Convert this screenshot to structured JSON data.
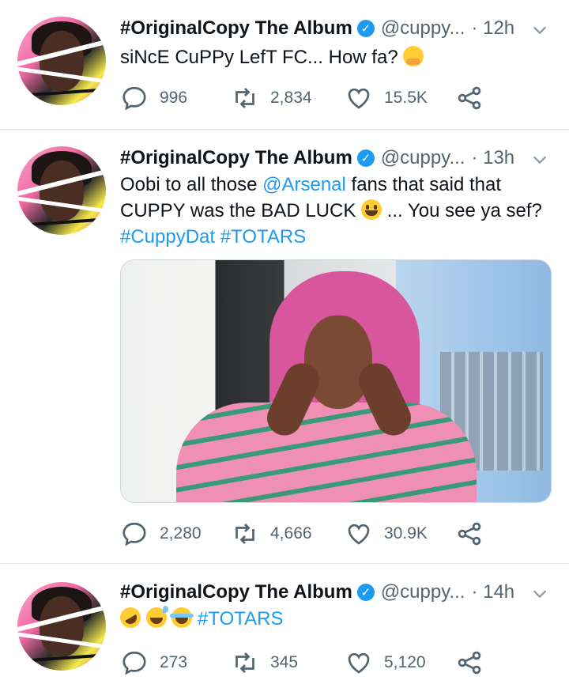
{
  "tweets": [
    {
      "name": "#OriginalCopy The Album",
      "handle": "@cuppy...",
      "time": "· 12h",
      "text": "siNcE CuPPy LefT FC... How fa?",
      "emojis": [
        "hugging-face"
      ],
      "stats": {
        "replies": "996",
        "retweets": "2,834",
        "likes": "15.5K"
      }
    },
    {
      "name": "#OriginalCopy The Album",
      "handle": "@cuppy...",
      "time": "· 13h",
      "text_a": "Oobi to all those ",
      "mention": "@Arsenal",
      "text_b": " fans that said that CUPPY was the BAD LUCK ",
      "text_c": " ... You see ya sef?",
      "hashtags": "#CuppyDat #TOTARS",
      "emojis": [
        "grinning-face"
      ],
      "stats": {
        "replies": "2,280",
        "retweets": "4,666",
        "likes": "30.9K"
      }
    },
    {
      "name": "#OriginalCopy The Album",
      "handle": "@cuppy...",
      "time": "· 14h",
      "hashtag": "#TOTARS",
      "emojis": [
        "rolling-on-floor-laughing",
        "grinning-sweat",
        "face-with-tears-of-joy"
      ],
      "stats": {
        "replies": "273",
        "retweets": "345",
        "likes": "5,120"
      }
    }
  ],
  "colors": {
    "link": "#1d9bf0",
    "muted": "#536471",
    "verified": "#1d9bf0"
  }
}
